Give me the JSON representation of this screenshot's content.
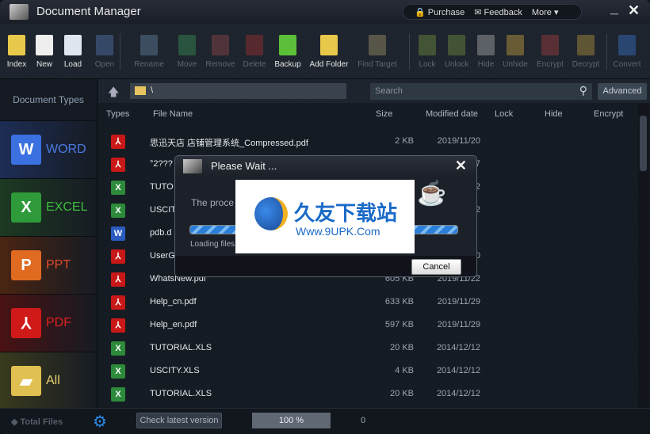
{
  "window": {
    "title": "Document Manager",
    "menu": {
      "purchase": "Purchase",
      "feedback": "Feedback",
      "more": "More ▾"
    },
    "minimize": "_",
    "close": "✕"
  },
  "toolbar": [
    {
      "label": "Index",
      "enabled": true,
      "icon": "index-folder-icon",
      "color": "#e8c84a"
    },
    {
      "label": "New",
      "enabled": true,
      "icon": "new-document-icon",
      "color": "#eeeeee"
    },
    {
      "label": "Load",
      "enabled": true,
      "icon": "load-document-icon",
      "color": "#e0e6ee"
    },
    {
      "label": "Open",
      "enabled": false,
      "icon": "open-word-icon",
      "color": "#5a7fbf"
    },
    {
      "label": "Rename",
      "enabled": false,
      "icon": "rename-icon",
      "color": "#6b8bb0"
    },
    {
      "label": "Move",
      "enabled": false,
      "icon": "move-icon",
      "color": "#3a9a5a"
    },
    {
      "label": "Remove",
      "enabled": false,
      "icon": "remove-icon",
      "color": "#9a4a4a"
    },
    {
      "label": "Delete",
      "enabled": false,
      "icon": "delete-icon",
      "color": "#a33"
    },
    {
      "label": "Backup",
      "enabled": true,
      "icon": "backup-table-icon",
      "color": "#5cbf3a"
    },
    {
      "label": "Add Folder",
      "enabled": true,
      "icon": "add-folder-icon",
      "color": "#e8c84a"
    },
    {
      "label": "Find Target",
      "enabled": false,
      "icon": "find-target-icon",
      "color": "#b0a070"
    },
    {
      "label": "Lock",
      "enabled": false,
      "icon": "lock-icon",
      "color": "#7a9a40"
    },
    {
      "label": "Unlock",
      "enabled": false,
      "icon": "unlock-icon",
      "color": "#7a9a40"
    },
    {
      "label": "Hide",
      "enabled": false,
      "icon": "cloud-icon",
      "color": "#bbbbbb"
    },
    {
      "label": "Unhide",
      "enabled": false,
      "icon": "sun-cloud-icon",
      "color": "#d8b040"
    },
    {
      "label": "Encrypt",
      "enabled": false,
      "icon": "encrypt-shield-icon",
      "color": "#b04040"
    },
    {
      "label": "Decrypt",
      "enabled": false,
      "icon": "decrypt-icon",
      "color": "#c0a040"
    },
    {
      "label": "Convert",
      "enabled": false,
      "icon": "convert-arrow-icon",
      "color": "#3a7ad8"
    }
  ],
  "sidebar": {
    "header": "Document Types",
    "items": [
      {
        "label": "WORD",
        "glyph": "W",
        "color": "#3a70e0",
        "text_color": "#4a7ae0",
        "bg": "#1d2d55"
      },
      {
        "label": "EXCEL",
        "glyph": "X",
        "color": "#2e9a3a",
        "text_color": "#3cbc3c",
        "bg": "#1d3a22"
      },
      {
        "label": "PPT",
        "glyph": "P",
        "color": "#e06a20",
        "text_color": "#e04a2a",
        "bg": "#4a2412"
      },
      {
        "label": "PDF",
        "glyph": "⅄",
        "color": "#d01a1a",
        "text_color": "#e02020",
        "bg": "#4a1212"
      },
      {
        "label": "All",
        "glyph": "▰",
        "color": "#e0c050",
        "text_color": "#e8d070",
        "bg": "#3a3a1e"
      }
    ]
  },
  "pathbar": {
    "path": "\\",
    "search_placeholder": "Search",
    "advanced": "Advanced"
  },
  "columns": [
    "Types",
    "File Name",
    "Size",
    "Modified date",
    "Lock",
    "Hide",
    "Encrypt"
  ],
  "files": [
    {
      "type": "pdf",
      "name": "思迅天店 店铺管理系统_Compressed.pdf",
      "size": "2 KB",
      "date": "2019/11/20"
    },
    {
      "type": "pdf",
      "name": "°2???",
      "size": "",
      "date": "7"
    },
    {
      "type": "xls",
      "name": "TUTO",
      "size": "",
      "date": "2"
    },
    {
      "type": "xls",
      "name": "USCIT",
      "size": "",
      "date": "2"
    },
    {
      "type": "doc",
      "name": "pdb.d",
      "size": "",
      "date": ""
    },
    {
      "type": "pdf",
      "name": "UserG",
      "size": "",
      "date": "0"
    },
    {
      "type": "pdf",
      "name": "WhatsNew.pdf",
      "size": "605 KB",
      "date": "2019/11/22"
    },
    {
      "type": "pdf",
      "name": "Help_cn.pdf",
      "size": "633 KB",
      "date": "2019/11/29"
    },
    {
      "type": "pdf",
      "name": "Help_en.pdf",
      "size": "597 KB",
      "date": "2019/11/29"
    },
    {
      "type": "xls",
      "name": "TUTORIAL.XLS",
      "size": "20 KB",
      "date": "2014/12/12"
    },
    {
      "type": "xls",
      "name": "USCITY.XLS",
      "size": "4 KB",
      "date": "2014/12/12"
    },
    {
      "type": "xls",
      "name": "TUTORIAL.XLS",
      "size": "20 KB",
      "date": "2014/12/12"
    }
  ],
  "status": {
    "total_files": "Total Files",
    "check_version": "Check latest version",
    "progress_label": "100 %",
    "progress": 100,
    "count": "0"
  },
  "dialog": {
    "title": "Please Wait ...",
    "message": "The proce",
    "loading": "Loading files",
    "cancel": "Cancel",
    "close": "✕",
    "progress": 100
  },
  "watermark": {
    "cn": "久友下载站",
    "url": "Www.9UPK.Com",
    "small": "WWW.9UPK.COM"
  }
}
